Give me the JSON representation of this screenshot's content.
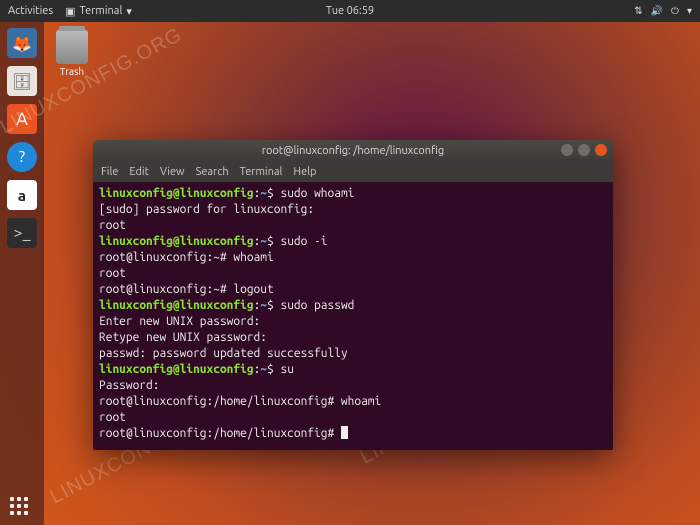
{
  "topbar": {
    "activities": "Activities",
    "app": "Terminal",
    "clock": "Tue 06:59"
  },
  "desktop": {
    "trash_label": "Trash"
  },
  "watermark": "LINUXCONFIG.ORG",
  "window": {
    "title": "root@linuxconfig: /home/linuxconfig",
    "menu": {
      "file": "File",
      "edit": "Edit",
      "view": "View",
      "search": "Search",
      "terminal": "Terminal",
      "help": "Help"
    }
  },
  "terminal": {
    "lines": [
      {
        "prompt_user": "linuxconfig@linuxconfig",
        "prompt_sep": ":",
        "prompt_path": "~",
        "prompt_end": "$ ",
        "cmd": "sudo whoami"
      },
      {
        "text": "[sudo] password for linuxconfig:"
      },
      {
        "text": "root"
      },
      {
        "prompt_user": "linuxconfig@linuxconfig",
        "prompt_sep": ":",
        "prompt_path": "~",
        "prompt_end": "$ ",
        "cmd": "sudo -i"
      },
      {
        "text": "root@linuxconfig:~# whoami"
      },
      {
        "text": "root"
      },
      {
        "text": "root@linuxconfig:~# logout"
      },
      {
        "prompt_user": "linuxconfig@linuxconfig",
        "prompt_sep": ":",
        "prompt_path": "~",
        "prompt_end": "$ ",
        "cmd": "sudo passwd"
      },
      {
        "text": "Enter new UNIX password:"
      },
      {
        "text": "Retype new UNIX password:"
      },
      {
        "text": "passwd: password updated successfully"
      },
      {
        "prompt_user": "linuxconfig@linuxconfig",
        "prompt_sep": ":",
        "prompt_path": "~",
        "prompt_end": "$ ",
        "cmd": "su"
      },
      {
        "text": "Password:"
      },
      {
        "text": "root@linuxconfig:/home/linuxconfig# whoami"
      },
      {
        "text": "root"
      },
      {
        "text": "root@linuxconfig:/home/linuxconfig# ",
        "cursor": true
      }
    ]
  }
}
